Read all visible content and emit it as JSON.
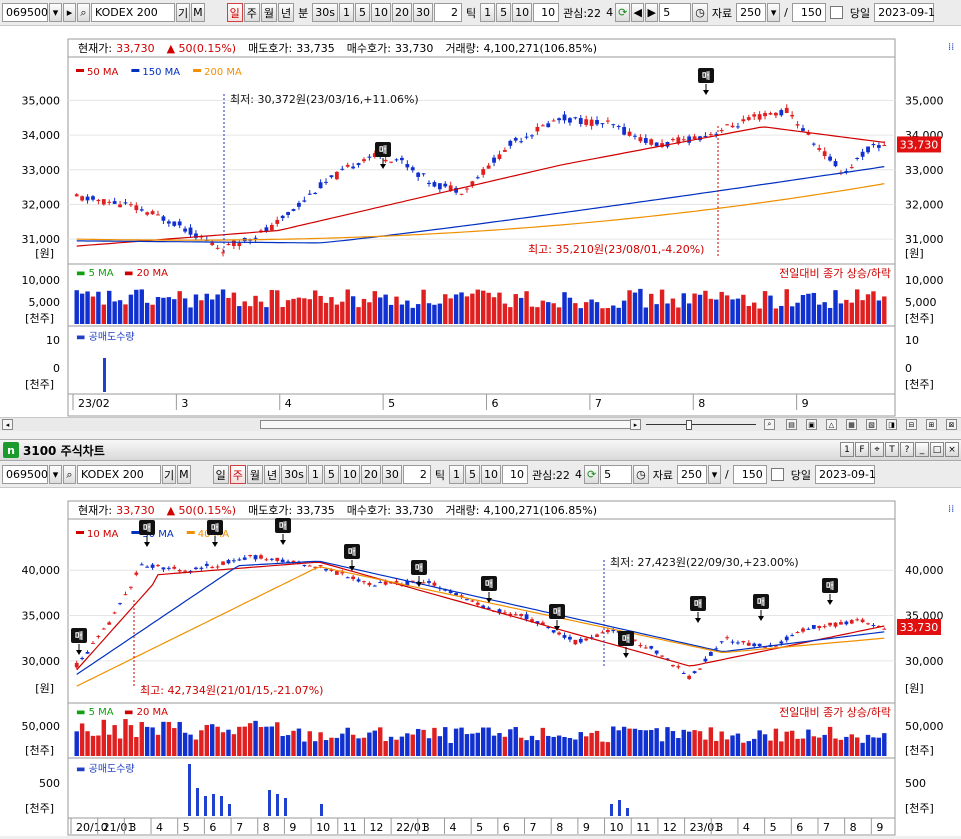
{
  "toolbar": {
    "code": "069500",
    "name": "KODEX 200",
    "name_btn_1": "기",
    "name_btn_2": "M",
    "periods": [
      "일",
      "주",
      "월",
      "년"
    ],
    "unit_label": "분",
    "minute_opts": [
      "30s",
      "1",
      "5",
      "10",
      "20",
      "30"
    ],
    "tick_value": "2",
    "tick_label": "틱",
    "tick_opts": [
      "1",
      "5",
      "10"
    ],
    "tick_value2": "10",
    "interest_label": "관심:22",
    "interest_value": "4",
    "step_value": "5",
    "data_label": "자료",
    "data_count": "250",
    "slash": "/",
    "data_count2": "150",
    "today_label": "당일",
    "date_value": "2023-09-1"
  },
  "window2": {
    "title": "3100 주식차트"
  },
  "charts": [
    {
      "id": "top",
      "quote": {
        "cur_label": "현재가:",
        "cur_value": "33,730",
        "chg_value": "50(0.15%)",
        "ask_label": "매도호가:",
        "ask_value": "33,735",
        "bid_label": "매수호가:",
        "bid_value": "33,730",
        "vol_label": "거래량:",
        "vol_value": "4,100,271(106.85%)"
      },
      "legend": [
        {
          "label": "50 MA",
          "color": "#d00000"
        },
        {
          "label": "150 MA",
          "color": "#0030c0"
        },
        {
          "label": "200 MA",
          "color": "#f09000"
        }
      ],
      "ann_low": "최저: 30,372원(23/03/16,+11.06%)",
      "ann_high": "최고: 35,210원(23/08/01,-4.20%)",
      "price_ticks": [
        "35,000",
        "34,000",
        "33,000",
        "32,000",
        "31,000"
      ],
      "price_unit": "[원]",
      "last_price": "33,730",
      "vol_legend": [
        "5 MA",
        "20 MA"
      ],
      "vol_note": "전일대비 종가 상승/하락",
      "vol_ticks": [
        "10,000",
        "5,000"
      ],
      "vol_unit": "[천주]",
      "short_label": "공매도수량",
      "short_ticks": [
        "10",
        "0"
      ],
      "short_unit": "[천주]",
      "x_labels": [
        "23/02",
        "3",
        "4",
        "5",
        "6",
        "7",
        "8",
        "9"
      ],
      "buy_badge": "매"
    },
    {
      "id": "bottom",
      "quote": {
        "cur_label": "현재가:",
        "cur_value": "33,730",
        "chg_value": "50(0.15%)",
        "ask_label": "매도호가:",
        "ask_value": "33,735",
        "bid_label": "매수호가:",
        "bid_value": "33,730",
        "vol_label": "거래량:",
        "vol_value": "4,100,271(106.85%)"
      },
      "legend": [
        {
          "label": "10 MA",
          "color": "#d00000"
        },
        {
          "label": "30 MA",
          "color": "#0030c0"
        },
        {
          "label": "40 MA",
          "color": "#f09000"
        }
      ],
      "ann_low": "최저: 27,423원(22/09/30,+23.00%)",
      "ann_high": "최고: 42,734원(21/01/15,-21.07%)",
      "price_ticks": [
        "40,000",
        "35,000",
        "30,000"
      ],
      "price_unit": "[원]",
      "last_price": "33,730",
      "vol_legend": [
        "5 MA",
        "20 MA"
      ],
      "vol_note": "전일대비 종가 상승/하락",
      "vol_ticks": [
        "50,000"
      ],
      "vol_unit": "[천주]",
      "short_label": "공매도수량",
      "short_ticks": [
        "500"
      ],
      "short_unit": "[천주]",
      "x_labels": [
        "20/10",
        "21/01",
        "3",
        "4",
        "5",
        "6",
        "7",
        "8",
        "9",
        "10",
        "11",
        "12",
        "22/01",
        "3",
        "4",
        "5",
        "6",
        "7",
        "8",
        "9",
        "10",
        "11",
        "12",
        "23/01",
        "3",
        "4",
        "5",
        "6",
        "7",
        "8",
        "9"
      ],
      "buy_badge": "매"
    }
  ],
  "colors": {
    "up": "#e02020",
    "down": "#1030d0",
    "label_red": "#d00000"
  }
}
